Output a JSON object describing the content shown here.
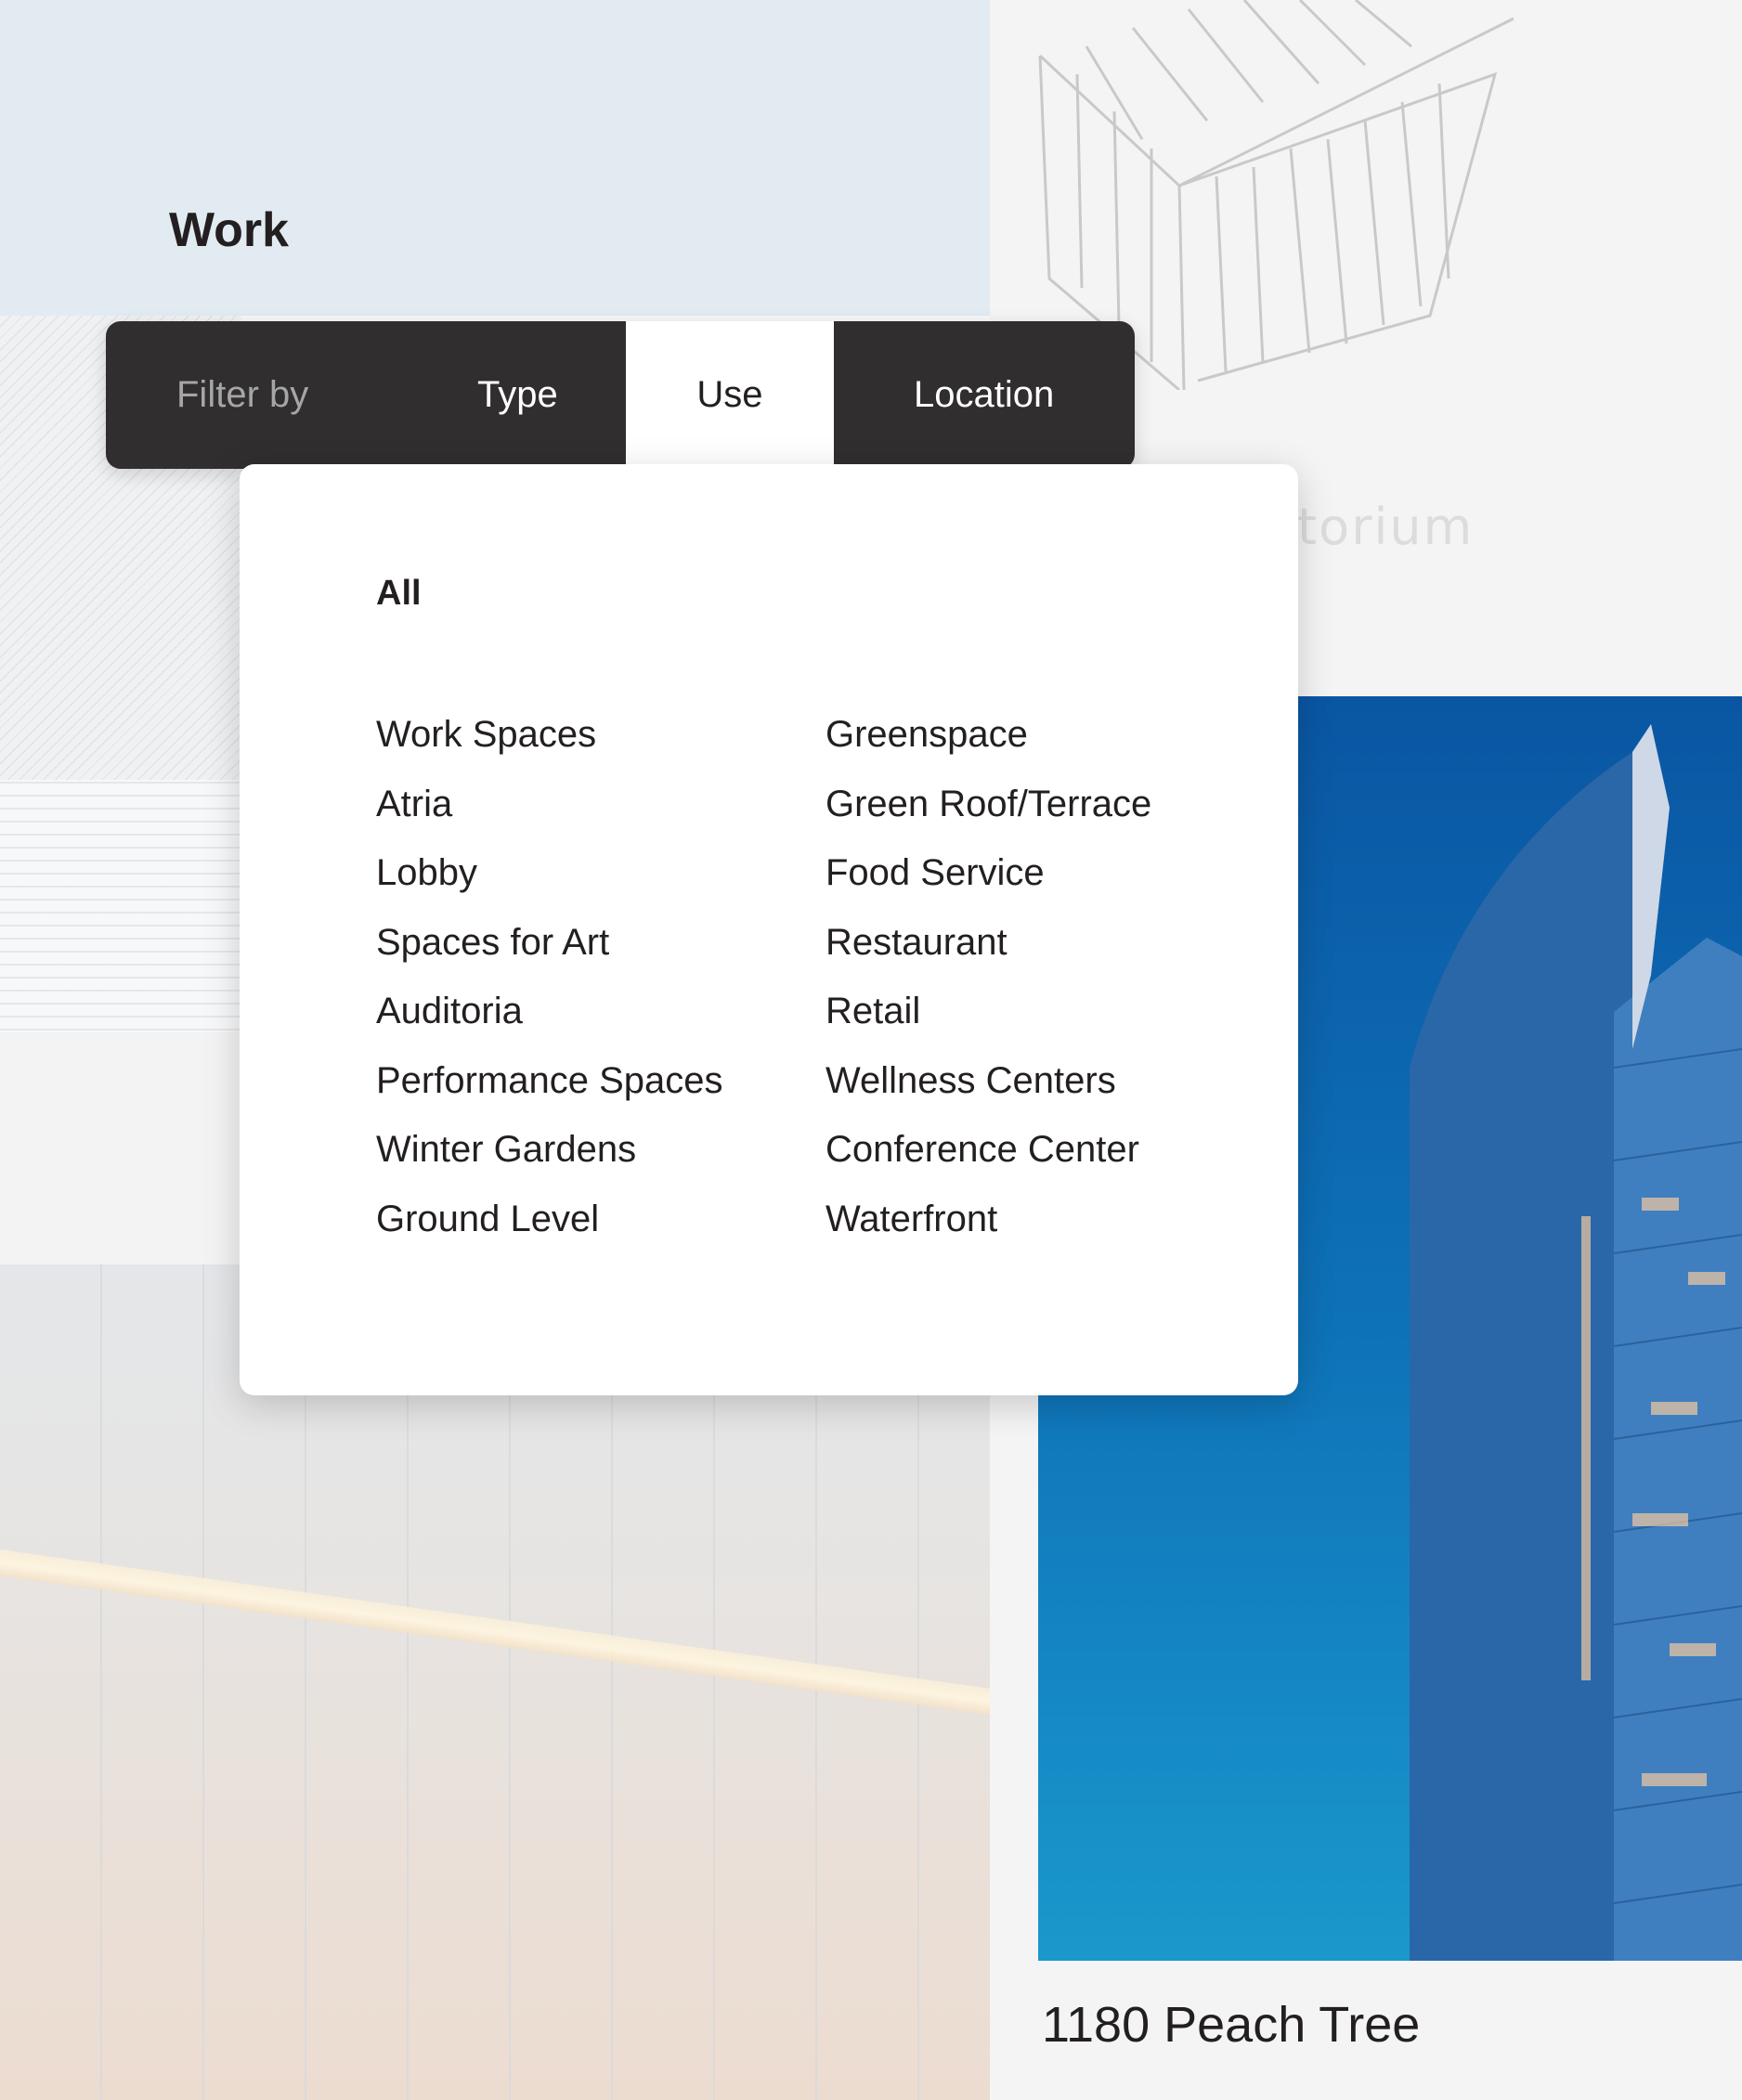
{
  "page": {
    "title": "Work"
  },
  "filter_bar": {
    "label": "Filter by",
    "tabs": [
      {
        "label": "Type",
        "active": false
      },
      {
        "label": "Use",
        "active": true
      },
      {
        "label": "Location",
        "active": false
      }
    ]
  },
  "dropdown": {
    "all_label": "All",
    "columns": [
      [
        "Work Spaces",
        "Atria",
        "Lobby",
        "Spaces for Art",
        "Auditoria",
        "Performance Spaces",
        "Winter Gardens",
        "Ground Level"
      ],
      [
        "Greenspace",
        "Green Roof/Terrace",
        "Food Service",
        "Restaurant",
        "Retail",
        "Wellness Centers",
        "Conference Center",
        "Waterfront"
      ]
    ]
  },
  "cards": {
    "ghost_title": "itorium",
    "featured_caption": "1180 Peach Tree"
  },
  "colors": {
    "bar_bg": "#302e2f",
    "active_tab_bg": "#ffffff",
    "text_dark": "#231f20",
    "filter_label": "#a6a6a6"
  }
}
